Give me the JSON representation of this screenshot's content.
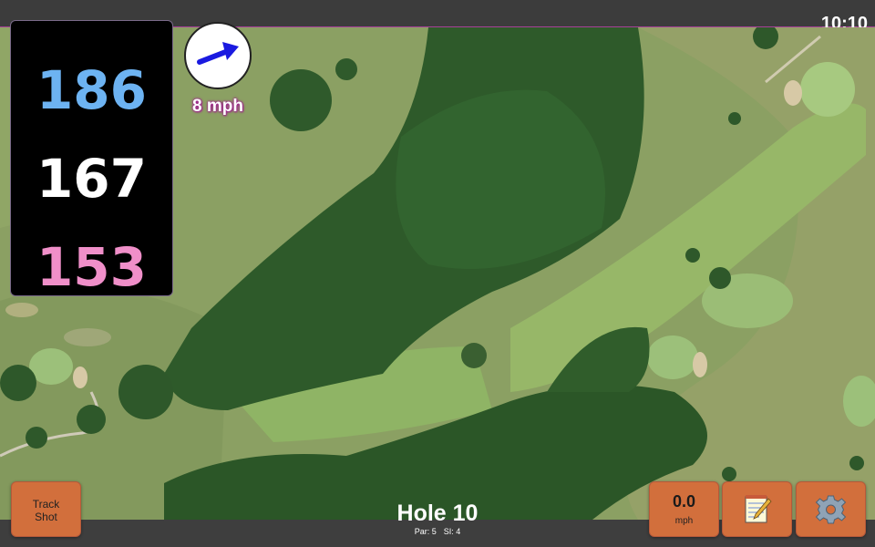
{
  "status_bar": {
    "time": "10:10"
  },
  "distances": {
    "back": "186",
    "middle": "167",
    "front": "153"
  },
  "wind": {
    "speed_label": "8 mph",
    "direction_icon": "wind-arrow-icon"
  },
  "buttons": {
    "track_shot_line1": "Track",
    "track_shot_line2": "Shot",
    "speed_value": "0.0",
    "speed_unit": "mph",
    "notes_icon": "notepad-icon",
    "settings_icon": "gear-icon"
  },
  "hole": {
    "title": "Hole 10",
    "par": "Par: 5",
    "si": "SI: 4"
  },
  "colors": {
    "button": "#d26f3c",
    "back_distance": "#6db3f2",
    "front_distance": "#f08fc9",
    "accent": "#a8409a"
  }
}
